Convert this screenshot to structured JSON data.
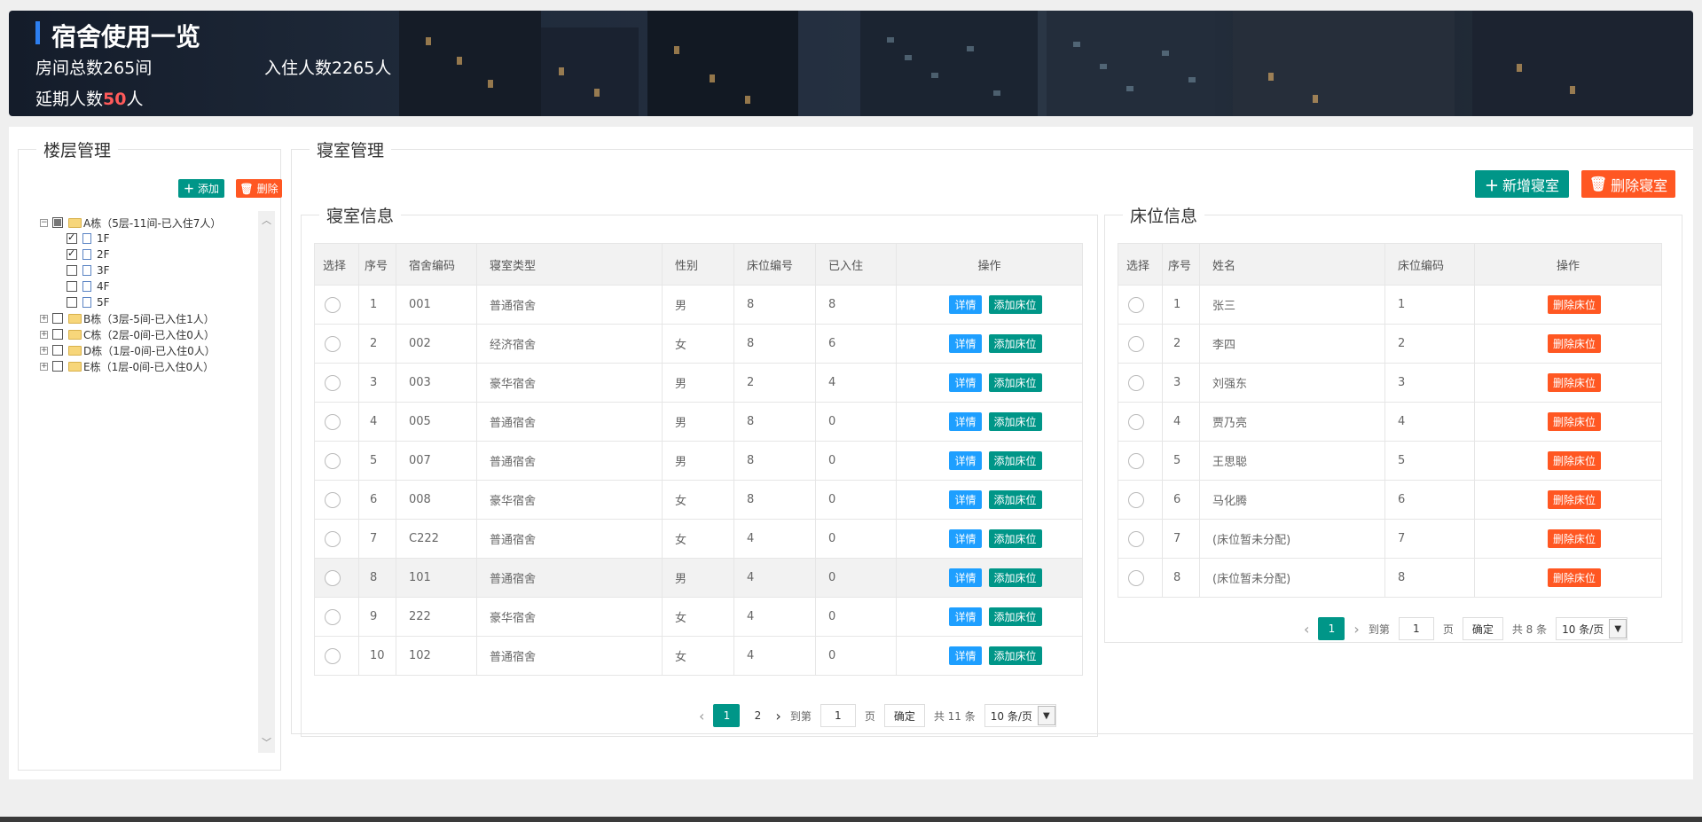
{
  "banner": {
    "title": "宿舍使用一览",
    "room_total_label": "房间总数265间",
    "resident_total_label": "入住人数2265人",
    "delay_prefix": "延期人数",
    "delay_count": "50",
    "delay_suffix": "人"
  },
  "floor_panel": {
    "legend": "楼层管理",
    "add_label": "添加",
    "delete_label": "删除",
    "tree": [
      {
        "label": "A栋（5层-11间-已入住7人）",
        "expanded": true,
        "children": [
          "1F",
          "2F",
          "3F",
          "4F",
          "5F"
        ]
      },
      {
        "label": "B栋（3层-5间-已入住1人）"
      },
      {
        "label": "C栋（2层-0间-已入住0人）"
      },
      {
        "label": "D栋（1层-0间-已入住0人）"
      },
      {
        "label": "E栋（1层-0间-已入住0人）"
      }
    ]
  },
  "dorm_panel": {
    "legend": "寝室管理",
    "new_label": "新增寝室",
    "delete_label": "删除寝室"
  },
  "room_info": {
    "legend": "寝室信息",
    "columns": [
      "选择",
      "序号",
      "宿舍编码",
      "寝室类型",
      "性别",
      "床位编号",
      "已入住",
      "操作"
    ],
    "rows": [
      [
        "1",
        "001",
        "普通宿舍",
        "男",
        "8",
        "8"
      ],
      [
        "2",
        "002",
        "经济宿舍",
        "女",
        "8",
        "6"
      ],
      [
        "3",
        "003",
        "豪华宿舍",
        "男",
        "2",
        "4"
      ],
      [
        "4",
        "005",
        "普通宿舍",
        "男",
        "8",
        "0"
      ],
      [
        "5",
        "007",
        "普通宿舍",
        "男",
        "8",
        "0"
      ],
      [
        "6",
        "008",
        "豪华宿舍",
        "女",
        "8",
        "0"
      ],
      [
        "7",
        "C222",
        "普通宿舍",
        "女",
        "4",
        "0"
      ],
      [
        "8",
        "101",
        "普通宿舍",
        "男",
        "4",
        "0"
      ],
      [
        "9",
        "222",
        "豪华宿舍",
        "女",
        "4",
        "0"
      ],
      [
        "10",
        "102",
        "普通宿舍",
        "女",
        "4",
        "0"
      ]
    ],
    "detail_label": "详情",
    "add_bed_label": "添加床位",
    "pager": {
      "current": "1",
      "next": "2",
      "goto_label": "到第",
      "goto_value": "1",
      "page_unit": "页",
      "confirm": "确定",
      "total": "共 11 条",
      "per_page": "10 条/页"
    }
  },
  "bed_info": {
    "legend": "床位信息",
    "columns": [
      "选择",
      "序号",
      "姓名",
      "床位编码",
      "操作"
    ],
    "rows": [
      [
        "1",
        "张三",
        "1"
      ],
      [
        "2",
        "李四",
        "2"
      ],
      [
        "3",
        "刘强东",
        "3"
      ],
      [
        "4",
        "贾乃亮",
        "4"
      ],
      [
        "5",
        "王思聪",
        "5"
      ],
      [
        "6",
        "马化腾",
        "6"
      ],
      [
        "7",
        "(床位暂未分配)",
        "7"
      ],
      [
        "8",
        "(床位暂未分配)",
        "8"
      ]
    ],
    "delete_bed_label": "删除床位",
    "pager": {
      "current": "1",
      "goto_label": "到第",
      "goto_value": "1",
      "page_unit": "页",
      "confirm": "确定",
      "total": "共 8 条",
      "per_page": "10 条/页"
    }
  },
  "colors": {
    "accent_green": "#009688",
    "accent_orange": "#ff5722",
    "accent_blue": "#1e9fff",
    "delay_red": "#ff5a5a"
  }
}
